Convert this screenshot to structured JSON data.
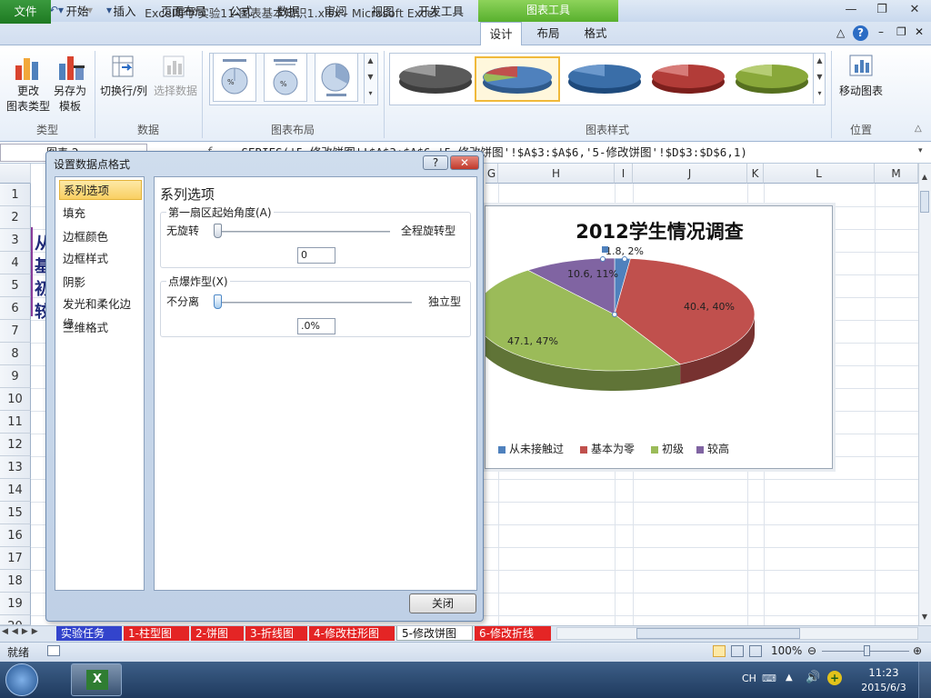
{
  "window": {
    "title": "Excel导学实验11-图表基本知识1.xlsx  -  Microsoft Excel",
    "context_tab_title": "图表工具"
  },
  "tabs": [
    "文件",
    "开始",
    "插入",
    "页面布局",
    "公式",
    "数据",
    "审阅",
    "视图",
    "开发工具",
    "设计",
    "布局",
    "格式"
  ],
  "active_tab": "设计",
  "ribbon": {
    "change_type_label": "更改\n图表类型",
    "save_template_label": "另存为\n模板",
    "switch_rowcol_label": "切换行/列",
    "select_data_label": "选择数据",
    "move_chart_label": "移动图表",
    "groups": {
      "type": "类型",
      "data": "数据",
      "layout": "图表布局",
      "styles": "图表样式",
      "location": "位置"
    }
  },
  "formula_bar": {
    "name_box": "图表 2",
    "formula": "=SERIES('5-修改饼图'!$A$3:$A$6,'5-修改饼图'!$A$3:$A$6,'5-修改饼图'!$D$3:$D$6,1)"
  },
  "columns": [
    "G",
    "H",
    "I",
    "J",
    "K",
    "L",
    "M"
  ],
  "rows": [
    "1",
    "2",
    "3",
    "4",
    "5",
    "6",
    "7",
    "8",
    "9",
    "10",
    "11",
    "12",
    "13",
    "14",
    "15",
    "16",
    "17",
    "18",
    "19",
    "20"
  ],
  "cell_fragments": [
    "从",
    "基",
    "初",
    "较"
  ],
  "chart_data": {
    "type": "pie",
    "title": "2012学生情况调查",
    "categories": [
      "从未接触过",
      "基本为零",
      "初级",
      "较高"
    ],
    "values": [
      1.8,
      40.4,
      47.1,
      10.6
    ],
    "percents": [
      "2%",
      "40%",
      "47%",
      "11%"
    ],
    "data_labels": [
      "1.8, 2%",
      "40.4, 40%",
      "47.1, 47%",
      "10.6, 11%"
    ],
    "colors": [
      "#4f81bd",
      "#c0504d",
      "#9bbb59",
      "#8064a2"
    ],
    "legend_position": "bottom",
    "three_d": true
  },
  "dialog": {
    "title": "设置数据点格式",
    "help_button": "?",
    "nav_items": [
      "系列选项",
      "填充",
      "边框颜色",
      "边框样式",
      "阴影",
      "发光和柔化边缘",
      "三维格式"
    ],
    "active_nav": "系列选项",
    "panel_title": "系列选项",
    "angle_section": {
      "legend": "第一扇区起始角度(A)",
      "min_label": "无旋转",
      "max_label": "全程旋转型",
      "value": "0",
      "slider_fraction": 0
    },
    "explode_section": {
      "legend": "点爆炸型(X)",
      "min_label": "不分离",
      "max_label": "独立型",
      "value": ".0%",
      "slider_fraction": 0
    },
    "close_button": "关闭"
  },
  "sheet_tabs": [
    "实验任务",
    "1-柱型图",
    "2-饼图",
    "3-折线图",
    "4-修改柱形图",
    "5-修改饼图",
    "6-修改折线"
  ],
  "active_sheet": "5-修改饼图",
  "status": {
    "mode": "就绪",
    "zoom": "100%"
  },
  "taskbar": {
    "lang": "CH",
    "time": "11:23",
    "date": "2015/6/3"
  }
}
